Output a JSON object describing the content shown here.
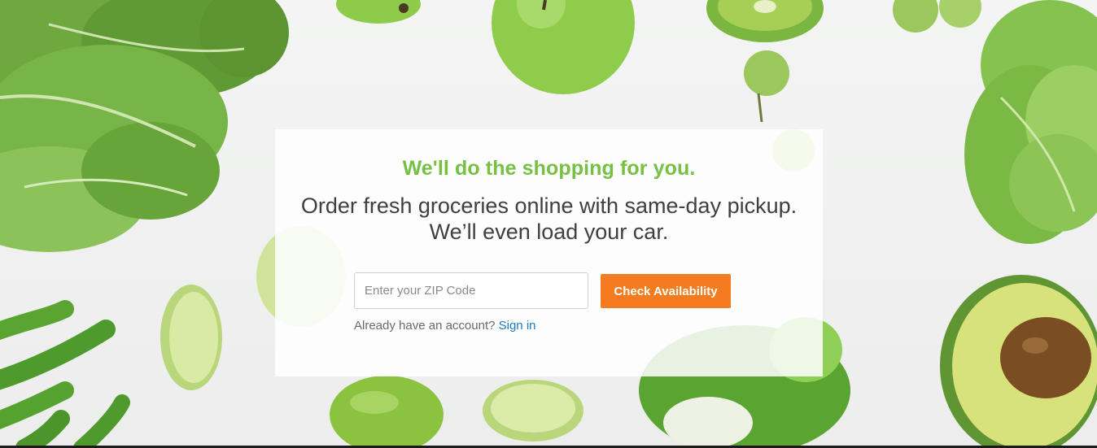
{
  "hero": {
    "headline": "We'll do the shopping for you.",
    "subline_1": "Order fresh groceries online with same-day pickup.",
    "subline_2": "We’ll even load your car."
  },
  "zip": {
    "placeholder": "Enter your ZIP Code",
    "value": ""
  },
  "actions": {
    "check_label": "Check Availability"
  },
  "signin": {
    "prompt": "Already have an account?",
    "link_label": "Sign in"
  },
  "colors": {
    "headline": "#76c043",
    "button": "#f47c20",
    "link": "#1a7ac6"
  }
}
